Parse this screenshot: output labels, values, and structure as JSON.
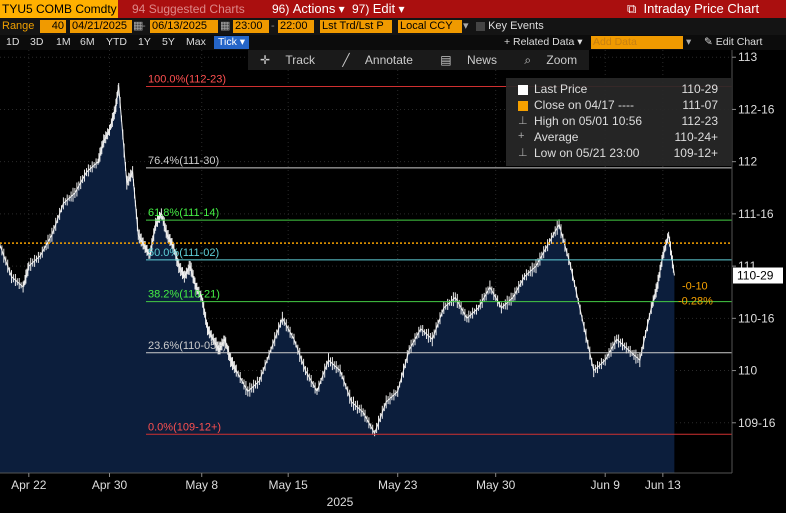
{
  "header": {
    "ticker": "TYU5 COMB Comdty",
    "suggested": "Suggested Charts",
    "actions_num": "96)",
    "actions": "Actions",
    "edit_num": "97)",
    "edit": "Edit",
    "title": "Intraday Price Chart"
  },
  "controls": {
    "range_label": "Range",
    "bars": "40",
    "start_date": "04/21/2025",
    "end_date": "06/13/2025",
    "start_time": "23:00",
    "end_time": "22:00",
    "price_type": "Lst Trd/Lst P",
    "currency": "Local CCY",
    "key_events": "Key Events"
  },
  "periods": [
    "1D",
    "3D",
    "1M",
    "6M",
    "YTD",
    "1Y",
    "5Y",
    "Max"
  ],
  "period_active": "Tick",
  "related_data": "+ Related Data",
  "add_data_placeholder": "Add Data",
  "edit_chart": "Edit Chart",
  "toolbar": [
    "Track",
    "Annotate",
    "News",
    "Zoom"
  ],
  "legend": [
    {
      "label": "Last Price",
      "value": "110-29",
      "color": "#ffffff"
    },
    {
      "label": "Close on 04/17 ----",
      "value": "111-07",
      "color": "#f5a000"
    },
    {
      "label": "High on 05/01 10:56",
      "value": "112-23",
      "color": "#aaaaaa"
    },
    {
      "label": "Average",
      "value": "110-24+",
      "color": "#aaaaaa"
    },
    {
      "label": "Low on 05/21 23:00",
      "value": "109-12+",
      "color": "#aaaaaa"
    }
  ],
  "chart_data": {
    "type": "area",
    "y_ticks": [
      {
        "v": 113,
        "label": "113"
      },
      {
        "v": 112.5,
        "label": "112-16"
      },
      {
        "v": 112,
        "label": "112"
      },
      {
        "v": 111.5,
        "label": "111-16"
      },
      {
        "v": 111,
        "label": "111"
      },
      {
        "v": 110.5,
        "label": "110-16"
      },
      {
        "v": 110,
        "label": "110"
      },
      {
        "v": 109.5,
        "label": "109-16"
      }
    ],
    "ylim": [
      109.0,
      113.05
    ],
    "x_ticks": [
      "Apr 22",
      "Apr 30",
      "May 8",
      "May 15",
      "May 23",
      "May 30",
      "Jun 9",
      "Jun 13"
    ],
    "x_tick_pos": [
      0.0,
      0.7,
      1.5,
      2.25,
      3.2,
      4.05,
      5.0,
      5.5
    ],
    "xlim": [
      -0.25,
      6.1
    ],
    "year_label": "2025",
    "fib_levels": [
      {
        "label": "100.0%(112-23)",
        "v": 112.72,
        "color": "#d03030",
        "text_color": "#ff5050"
      },
      {
        "label": "76.4%(111-30)",
        "v": 111.94,
        "color": "#cccccc",
        "text_color": "#cccccc"
      },
      {
        "label": "61.8%(111-14)",
        "v": 111.44,
        "color": "#44cc44",
        "text_color": "#44ee44"
      },
      {
        "label": "50.0%(111-02)",
        "v": 111.06,
        "color": "#5fd0d8",
        "text_color": "#5fd0d8"
      },
      {
        "label": "38.2%(110-21)",
        "v": 110.66,
        "color": "#44cc44",
        "text_color": "#44ee44"
      },
      {
        "label": "23.6%(110-05+)",
        "v": 110.17,
        "color": "#cccccc",
        "text_color": "#cccccc"
      },
      {
        "label": "0.0%(109-12+)",
        "v": 109.39,
        "color": "#d03030",
        "text_color": "#ff5050"
      }
    ],
    "close_line": 111.22,
    "last_price": {
      "v": 110.91,
      "label": "110-29"
    },
    "change": "-0-10",
    "change_pct": "-0.28%",
    "x": [
      -0.25,
      -0.15,
      -0.05,
      0.0,
      0.1,
      0.2,
      0.3,
      0.4,
      0.5,
      0.6,
      0.65,
      0.7,
      0.75,
      0.78,
      0.85,
      0.9,
      0.95,
      1.0,
      1.05,
      1.1,
      1.15,
      1.2,
      1.25,
      1.3,
      1.35,
      1.4,
      1.45,
      1.5,
      1.55,
      1.6,
      1.65,
      1.7,
      1.75,
      1.8,
      1.9,
      2.0,
      2.1,
      2.2,
      2.3,
      2.4,
      2.5,
      2.6,
      2.7,
      2.8,
      2.9,
      3.0,
      3.1,
      3.2,
      3.3,
      3.4,
      3.5,
      3.6,
      3.7,
      3.8,
      3.9,
      4.0,
      4.1,
      4.2,
      4.3,
      4.4,
      4.5,
      4.6,
      4.7,
      4.8,
      4.9,
      5.0,
      5.1,
      5.2,
      5.3,
      5.4,
      5.45,
      5.5,
      5.55,
      5.6
    ],
    "values": [
      111.2,
      110.9,
      110.8,
      111.0,
      111.1,
      111.3,
      111.6,
      111.7,
      111.9,
      112.0,
      112.2,
      112.3,
      112.5,
      112.72,
      111.8,
      111.9,
      111.3,
      111.2,
      111.1,
      111.4,
      111.5,
      111.3,
      111.2,
      111.0,
      110.9,
      111.0,
      110.8,
      110.7,
      110.4,
      110.3,
      110.2,
      110.3,
      110.1,
      110.0,
      109.8,
      109.9,
      110.2,
      110.5,
      110.3,
      110.0,
      109.8,
      110.1,
      110.0,
      109.7,
      109.6,
      109.4,
      109.7,
      109.8,
      110.2,
      110.4,
      110.3,
      110.6,
      110.7,
      110.5,
      110.6,
      110.8,
      110.6,
      110.7,
      110.9,
      111.0,
      111.2,
      111.4,
      111.0,
      110.5,
      110.0,
      110.1,
      110.3,
      110.2,
      110.1,
      110.6,
      110.8,
      111.1,
      111.3,
      110.91
    ]
  }
}
